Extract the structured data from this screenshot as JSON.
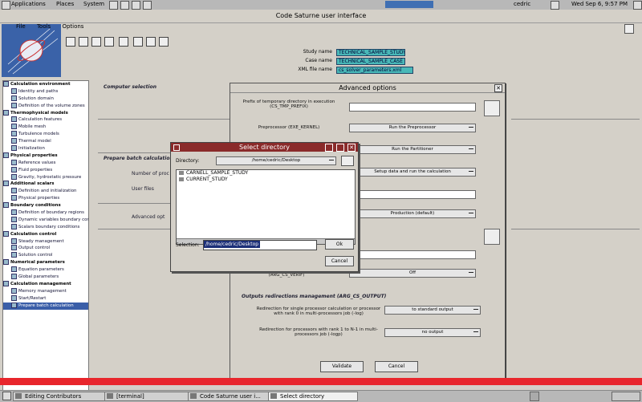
{
  "panel": {
    "applications": "Applications",
    "places": "Places",
    "system": "System",
    "user": "cedric",
    "clock": "Wed Sep 6, 9:57 PM"
  },
  "window": {
    "title": "Code Saturne user interface",
    "menu": [
      "File",
      "Tools",
      "Options"
    ]
  },
  "header": {
    "study_label": "Study name",
    "study_value": "TECHNICAL_SAMPLE_STUDY",
    "case_label": "Case name",
    "case_value": "TECHNICAL_SAMPLE_CASE",
    "xml_label": "XML file name",
    "xml_value": "cs_solver_parameters.xml"
  },
  "tree": [
    {
      "label": "Calculation environment",
      "kind": "cat"
    },
    {
      "label": "Identity and paths",
      "kind": "sub"
    },
    {
      "label": "Solution domain",
      "kind": "sub"
    },
    {
      "label": "Definition of the volume zones",
      "kind": "sub"
    },
    {
      "label": "Thermophysical models",
      "kind": "cat"
    },
    {
      "label": "Calculation features",
      "kind": "sub"
    },
    {
      "label": "Mobile mesh",
      "kind": "sub"
    },
    {
      "label": "Turbulence models",
      "kind": "sub"
    },
    {
      "label": "Thermal model",
      "kind": "sub"
    },
    {
      "label": "Initialization",
      "kind": "sub"
    },
    {
      "label": "Physical properties",
      "kind": "cat"
    },
    {
      "label": "Reference values",
      "kind": "sub"
    },
    {
      "label": "Fluid properties",
      "kind": "sub"
    },
    {
      "label": "Gravity, hydrostatic pressure",
      "kind": "sub"
    },
    {
      "label": "Additional scalars",
      "kind": "cat"
    },
    {
      "label": "Definition and initialization",
      "kind": "sub"
    },
    {
      "label": "Physical properties",
      "kind": "sub"
    },
    {
      "label": "Boundary conditions",
      "kind": "cat"
    },
    {
      "label": "Definition of boundary regions",
      "kind": "sub"
    },
    {
      "label": "Dynamic variables boundary conditions",
      "kind": "sub"
    },
    {
      "label": "Scalars boundary conditions",
      "kind": "sub"
    },
    {
      "label": "Calculation control",
      "kind": "cat"
    },
    {
      "label": "Steady management",
      "kind": "sub"
    },
    {
      "label": "Output control",
      "kind": "sub"
    },
    {
      "label": "Solution control",
      "kind": "sub"
    },
    {
      "label": "Numerical parameters",
      "kind": "cat"
    },
    {
      "label": "Equation parameters",
      "kind": "sub"
    },
    {
      "label": "Global parameters",
      "kind": "sub"
    },
    {
      "label": "Calculation management",
      "kind": "cat"
    },
    {
      "label": "Memory management",
      "kind": "sub"
    },
    {
      "label": "Start/Restart",
      "kind": "sub"
    },
    {
      "label": "Prepare batch calculation",
      "kind": "sub",
      "selected": true
    }
  ],
  "main": {
    "computer_selection": "Computer selection",
    "prepare_batch": "Prepare batch calculation",
    "number_of_proc": "Number of proc",
    "user_files": "User files",
    "advanced_opt": "Advanced opt"
  },
  "advanced": {
    "title": "Advanced options",
    "prefix_label": "Prefix of temporary directory in execution (CS_TMP_PREFIX)",
    "preprocessor_label": "Preprocessor (EXE_KERNEL)",
    "preprocessor_value": "Run the Preprocessor",
    "partitioner_value": "Run the Partitioner",
    "kernel_value": "Setup data and run the calculation",
    "prod_value": "Production (default)",
    "valgrind_label": "(ARG_CS_VERIF)",
    "valgrind_value": "Off",
    "redirect_title": "Outputs redirections management (ARG_CS_OUTPUT)",
    "single_proc_label": "Redirection for single processor calculation or processor with rank 0 in multi-processors job (-log)",
    "single_proc_value": "to standard output",
    "multi_proc_label": "Redirection for processors with rank 1 to N-1 in multi-processors job (-logp)",
    "multi_proc_value": "no output",
    "validate": "Validate",
    "cancel": "Cancel"
  },
  "select_dir": {
    "title": "Select directory",
    "directory_label": "Directory:",
    "directory_value": "/home/cedric/Desktop",
    "entries": [
      "CARNELL_SAMPLE_STUDY",
      "CURRENT_STUDY"
    ],
    "selection_label": "Selection:",
    "selection_value": "/home/cedric/Desktop",
    "ok": "Ok",
    "cancel": "Cancel"
  },
  "taskbar": {
    "items": [
      {
        "label": "Editing Contributors",
        "active": false
      },
      {
        "label": "[terminal]",
        "active": false
      },
      {
        "label": "Code Saturne user i...",
        "active": false
      },
      {
        "label": "Select directory",
        "active": true
      }
    ]
  }
}
